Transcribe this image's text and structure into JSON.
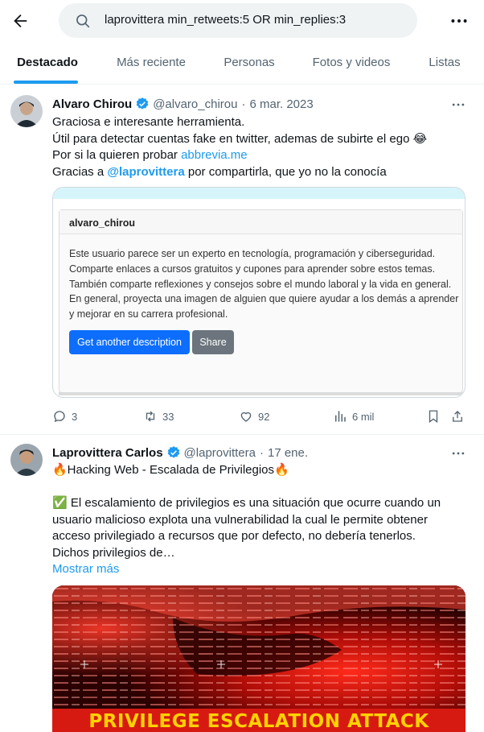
{
  "search": {
    "query": "laprovittera min_retweets:5 OR min_replies:3"
  },
  "tabs": [
    {
      "label": "Destacado",
      "active": true
    },
    {
      "label": "Más reciente"
    },
    {
      "label": "Personas"
    },
    {
      "label": "Fotos y videos"
    },
    {
      "label": "Listas"
    }
  ],
  "tweets": [
    {
      "name": "Alvaro Chirou",
      "handle": "@alvaro_chirou",
      "sep": "·",
      "date": "6 mar. 2023",
      "lines": [
        "Graciosa e interesante herramienta.",
        "Útil para detectar cuentas fake en twitter, ademas de subirte el ego 😂",
        "Por si la quieren probar ",
        "abbrevia.me",
        "Gracias a ",
        "@laprovittera",
        " por compartirla,  que yo no la conocía"
      ],
      "card": {
        "title": "alvaro_chirou",
        "description": [
          "Este usuario parece ser un experto en tecnología, programación y ciberseguridad.",
          "Comparte enlaces a cursos gratuitos y cupones para aprender sobre estos temas.",
          "También comparte reflexiones y consejos sobre el mundo laboral y la vida en general.",
          "En general, proyecta una imagen de alguien que quiere ayudar a los demás a aprender",
          "y mejorar en su carrera profesional."
        ],
        "primary_button": "Get another description",
        "secondary_button": "Share"
      },
      "stats": {
        "replies": "3",
        "retweets": "33",
        "likes": "92",
        "views": "6 mil"
      }
    },
    {
      "name": "Laprovittera Carlos",
      "handle": "@laprovittera",
      "sep": "·",
      "date": "17 ene.",
      "lines": [
        "🔥Hacking Web - Escalada de Privilegios🔥",
        "✅ El escalamiento de privilegios es una situación que ocurre cuando un",
        "usuario malicioso explota una vulnerabilidad la cual le permite  obtener",
        "acceso privilegiado a recursos que por defecto, no debería tenerlos.",
        "Dichos privilegios de…"
      ],
      "show_more": "Mostrar más",
      "media_caption": "PRIVILEGE ESCALATION ATTACK"
    }
  ],
  "colors": {
    "accent": "#1d9bf0",
    "text": "#0f1419",
    "muted": "#536471",
    "divider": "#eff3f4"
  }
}
